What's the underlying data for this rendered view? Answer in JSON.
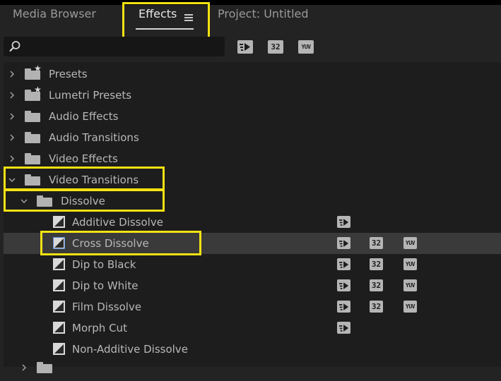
{
  "tabs": {
    "media_browser": "Media Browser",
    "effects": "Effects",
    "project": "Project: Untitled"
  },
  "toolbar": {
    "accelerated_badge": "",
    "bit_badge": "32",
    "yuv_badge": "YUV"
  },
  "tree": {
    "presets": "Presets",
    "lumetri_presets": "Lumetri Presets",
    "audio_effects": "Audio Effects",
    "audio_transitions": "Audio Transitions",
    "video_effects": "Video Effects",
    "video_transitions": "Video Transitions",
    "dissolve": "Dissolve",
    "effects": [
      {
        "label": "Additive Dissolve",
        "accelerated": true,
        "bit32": false,
        "yuv": false,
        "selected": false
      },
      {
        "label": "Cross Dissolve",
        "accelerated": true,
        "bit32": true,
        "yuv": true,
        "selected": true
      },
      {
        "label": "Dip to Black",
        "accelerated": true,
        "bit32": true,
        "yuv": true,
        "selected": false
      },
      {
        "label": "Dip to White",
        "accelerated": true,
        "bit32": true,
        "yuv": true,
        "selected": false
      },
      {
        "label": "Film Dissolve",
        "accelerated": true,
        "bit32": true,
        "yuv": true,
        "selected": false
      },
      {
        "label": "Morph Cut",
        "accelerated": true,
        "bit32": false,
        "yuv": false,
        "selected": false
      },
      {
        "label": "Non-Additive Dissolve",
        "accelerated": false,
        "bit32": false,
        "yuv": false,
        "selected": false
      }
    ]
  },
  "colors": {
    "highlight": "#f5e212",
    "background": "#1d1d1d",
    "selected_row": "#3a3a3a"
  }
}
